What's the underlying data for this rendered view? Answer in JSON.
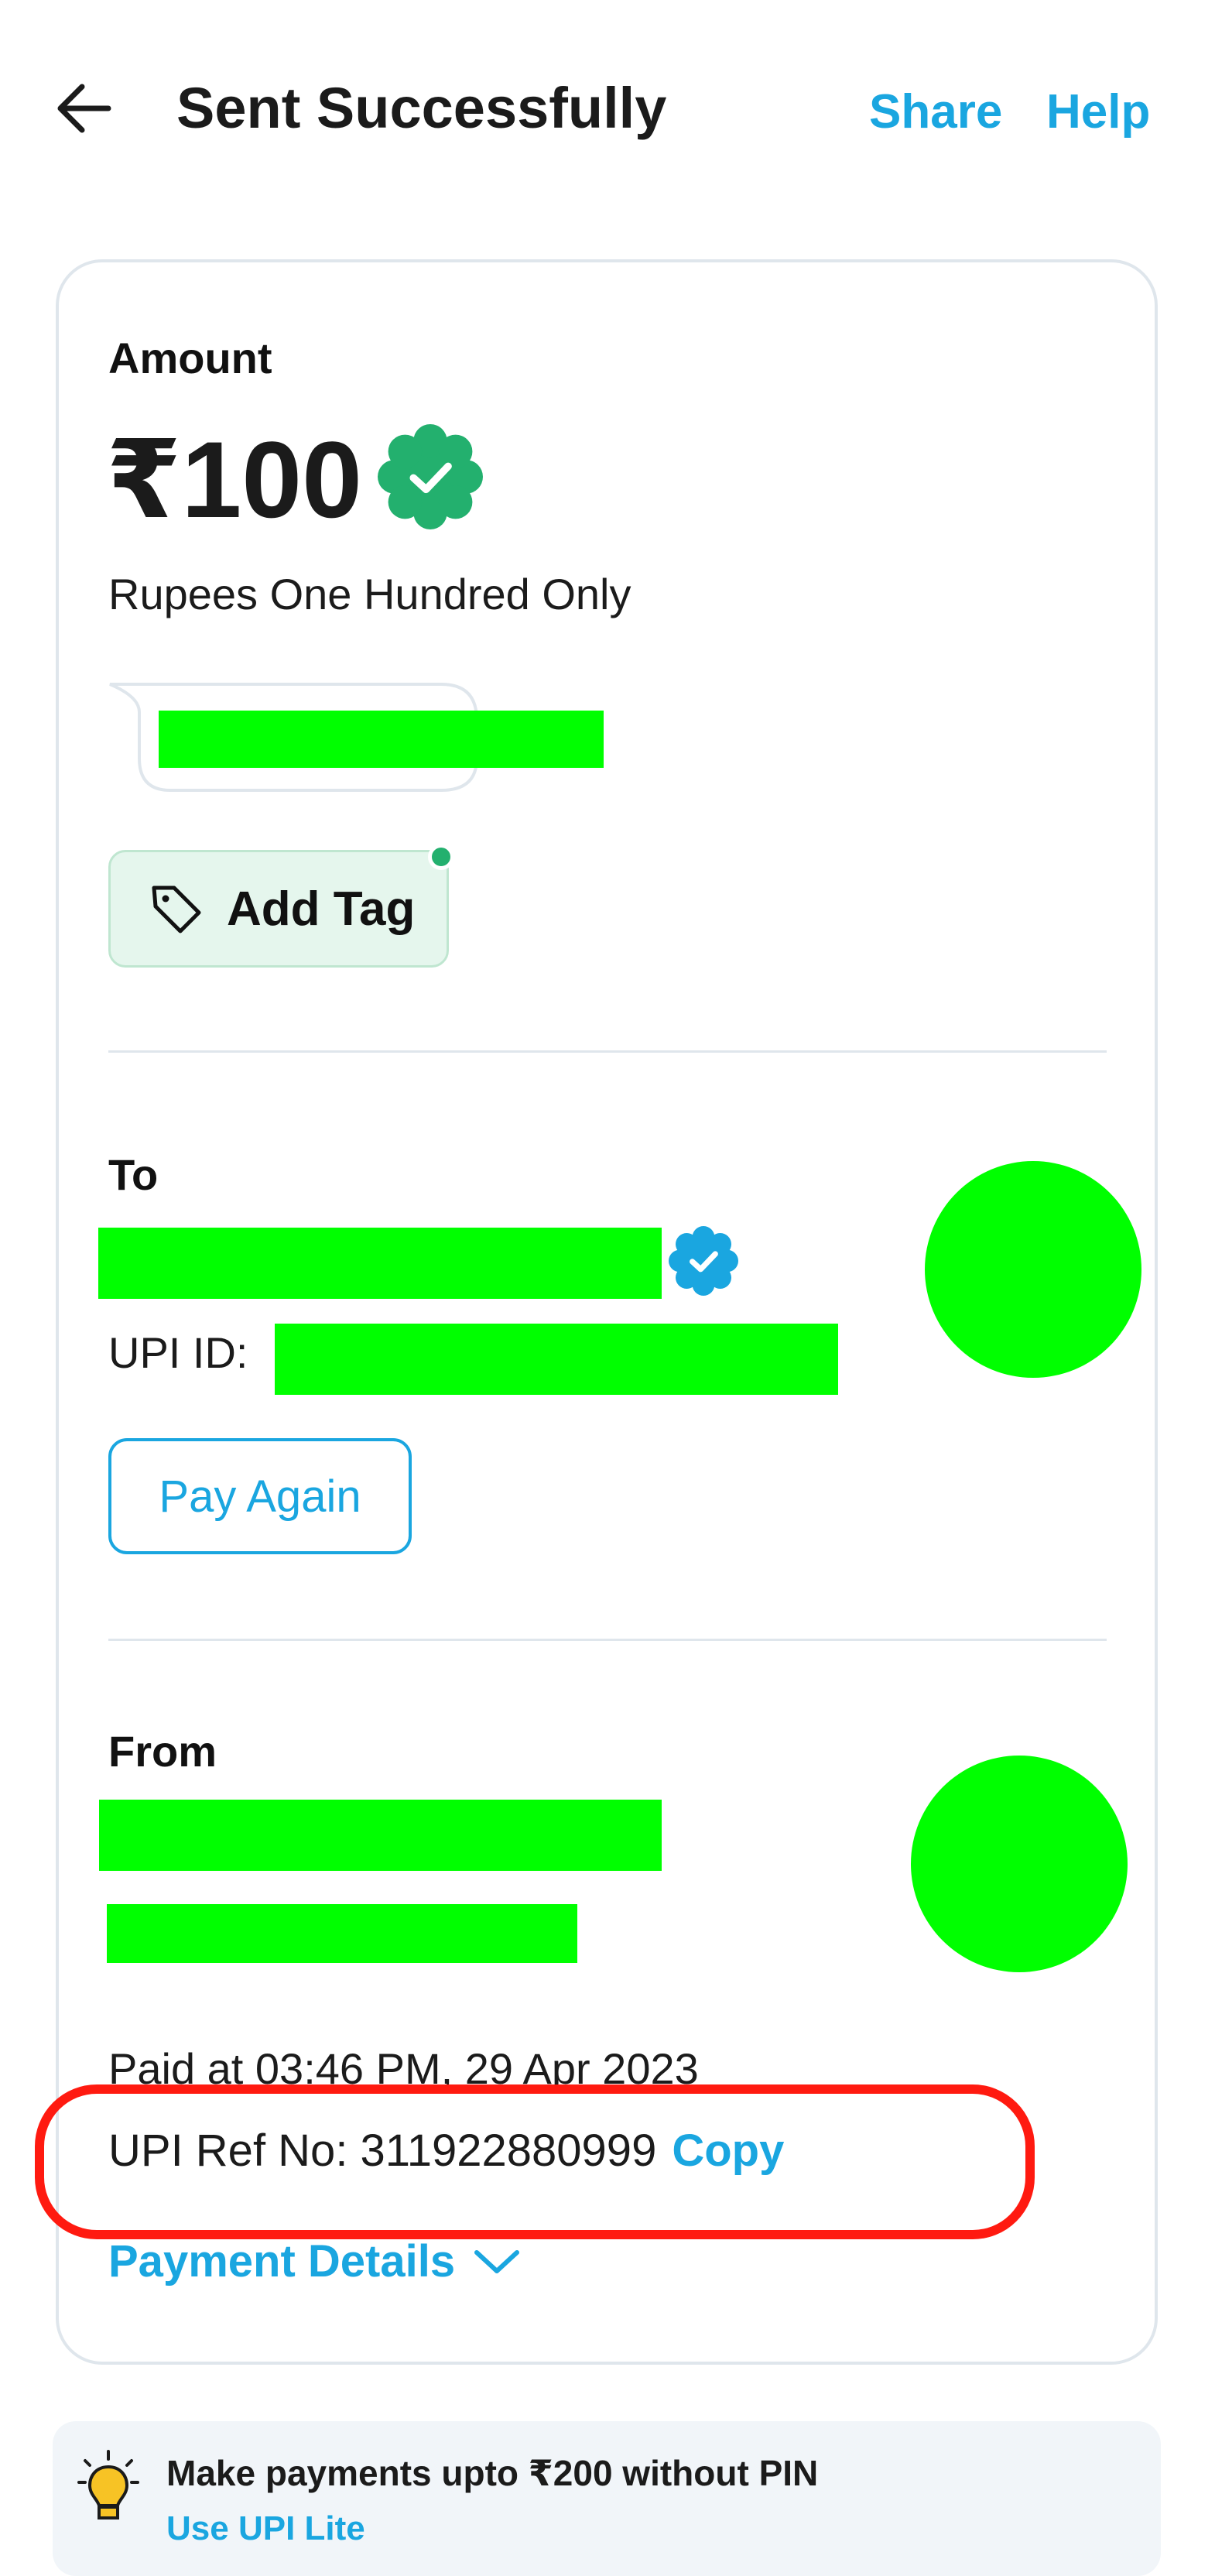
{
  "header": {
    "title": "Sent Successfully",
    "share_label": "Share",
    "help_label": "Help"
  },
  "amount_section": {
    "label": "Amount",
    "amount": "₹100",
    "amount_in_words": "Rupees One Hundred Only",
    "add_tag_label": "Add Tag"
  },
  "to_section": {
    "label": "To",
    "upi_id_label": "UPI ID:",
    "pay_again_label": "Pay Again"
  },
  "from_section": {
    "label": "From",
    "paid_at": "Paid at 03:46 PM, 29 Apr 2023",
    "upi_ref_label": "UPI Ref No: 311922880999",
    "copy_label": "Copy",
    "payment_details_label": "Payment Details"
  },
  "tip": {
    "title": "Make payments upto ₹200 without PIN",
    "link": "Use UPI Lite"
  },
  "colors": {
    "accent": "#1aa6e0",
    "success_green": "#23b06e",
    "highlight_red": "#ff1a10",
    "redaction_green": "#00ff00"
  },
  "icons": {
    "back": "arrow-left-icon",
    "verified": "verified-badge-icon",
    "tag": "tag-icon",
    "chevron": "chevron-down-icon",
    "bulb": "lightbulb-icon"
  }
}
